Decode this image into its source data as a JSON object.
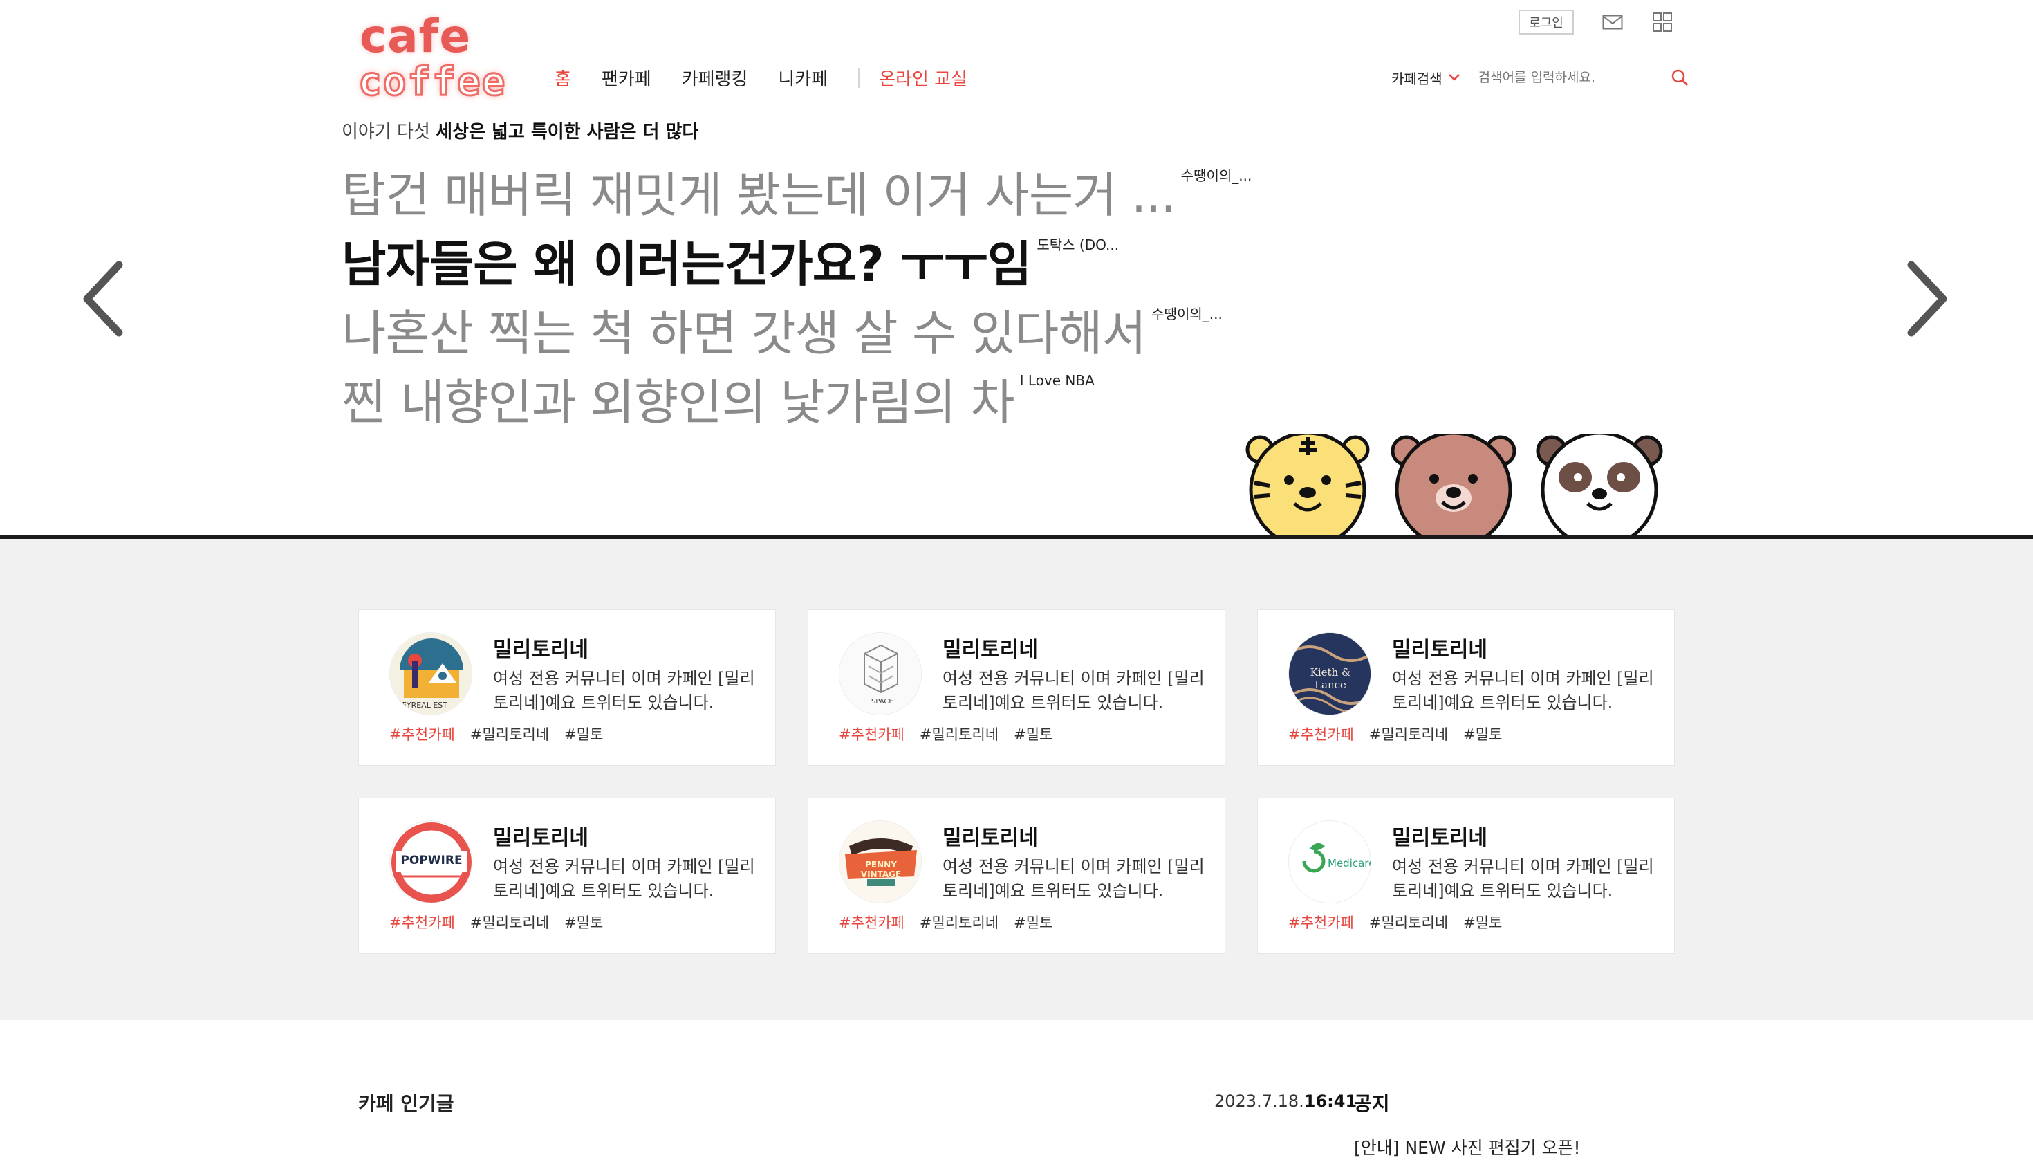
{
  "header": {
    "logo_line1": "cafe",
    "logo_line2": "coffee",
    "nav": [
      {
        "label": "홈",
        "active": true
      },
      {
        "label": "팬카페"
      },
      {
        "label": "카페랭킹"
      },
      {
        "label": "니카페"
      },
      {
        "label": "온라인 교실",
        "accent": true
      }
    ],
    "login_label": "로그인",
    "search": {
      "scope_label": "카페검색",
      "placeholder": "검색어를 입력하세요."
    }
  },
  "tagline": {
    "prefix": "이야기 다섯",
    "emphasis": "세상은 넓고 특이한 사람은 더 많다"
  },
  "posts": [
    {
      "title": "탑건 매버릭 재밋게 봤는데 이거 사는거 ...",
      "author": "수땡이의_..."
    },
    {
      "title": "남자들은 왜 이러는건가요? ㅜㅜ임",
      "author": "도탁스 (DO..."
    },
    {
      "title": "나혼산 찍는 척 하면 갓생 살 수 있다해서",
      "author": "수땡이의_..."
    },
    {
      "title": "찐 내향인과 외향인의 낯가림의 차",
      "author": "I Love NBA"
    }
  ],
  "cards": [
    {
      "name": "밀리토리네",
      "desc": "여성 전용 커뮤니티 이며 카페인 [밀리토리네]예요 트위터도 있습니다.",
      "tags": [
        "#추천카페",
        "#밀리토리네",
        "#밀토"
      ],
      "logo_text": "AFYREAL EST"
    },
    {
      "name": "밀리토리네",
      "desc": "여성 전용 커뮤니티 이며 카페인 [밀리토리네]예요 트위터도 있습니다.",
      "tags": [
        "#추천카페",
        "#밀리토리네",
        "#밀토"
      ],
      "logo_text": "SPACE"
    },
    {
      "name": "밀리토리네",
      "desc": "여성 전용 커뮤니티 이며 카페인 [밀리토리네]예요 트위터도 있습니다.",
      "tags": [
        "#추천카페",
        "#밀리토리네",
        "#밀토"
      ],
      "logo_text": "Kieth & Lance"
    },
    {
      "name": "밀리토리네",
      "desc": "여성 전용 커뮤니티 이며 카페인 [밀리토리네]예요 트위터도 있습니다.",
      "tags": [
        "#추천카페",
        "#밀리토리네",
        "#밀토"
      ],
      "logo_text": "POPWIRE"
    },
    {
      "name": "밀리토리네",
      "desc": "여성 전용 커뮤니티 이며 카페인 [밀리토리네]예요 트위터도 있습니다.",
      "tags": [
        "#추천카페",
        "#밀리토리네",
        "#밀토"
      ],
      "logo_text": "PENNY VINTAGE"
    },
    {
      "name": "밀리토리네",
      "desc": "여성 전용 커뮤니티 이며 카페인 [밀리토리네]예요 트위터도 있습니다.",
      "tags": [
        "#추천카페",
        "#밀리토리네",
        "#밀토"
      ],
      "logo_text": "Medicare"
    }
  ],
  "bottom": {
    "popular_title": "카페 인기글",
    "notice_date": "2023.7.18.",
    "notice_time": "16:41",
    "notice_label": "공지",
    "notice_item": "[안내] NEW 사진 편집기 오픈!"
  },
  "colors": {
    "accent": "#e8473f",
    "logo": "#e85a55",
    "band": "#f1f1f1",
    "divider": "#1a1a1a"
  }
}
